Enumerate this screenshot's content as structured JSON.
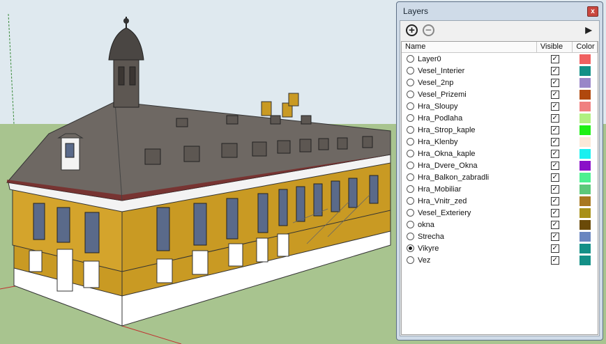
{
  "panel": {
    "title": "Layers",
    "close_label": "x",
    "toolbar": {
      "add_icon": "plus-circle-icon",
      "remove_icon": "minus-circle-icon",
      "details_icon": "details-arrow-icon"
    },
    "columns": {
      "name": "Name",
      "visible": "Visible",
      "color": "Color"
    },
    "layers": [
      {
        "name": "Layer0",
        "visible": true,
        "color": "#f06060",
        "active": false
      },
      {
        "name": "Vesel_Interier",
        "visible": true,
        "color": "#139087",
        "active": false
      },
      {
        "name": "Vesel_2np",
        "visible": true,
        "color": "#9a86c8",
        "active": false
      },
      {
        "name": "Vesel_Prizemi",
        "visible": true,
        "color": "#b0480d",
        "active": false
      },
      {
        "name": "Hra_Sloupy",
        "visible": true,
        "color": "#f08080",
        "active": false
      },
      {
        "name": "Hra_Podlaha",
        "visible": true,
        "color": "#b0f080",
        "active": false
      },
      {
        "name": "Hra_Strop_kaple",
        "visible": true,
        "color": "#1ef015",
        "active": false
      },
      {
        "name": "Hra_Klenby",
        "visible": true,
        "color": "#fae8d8",
        "active": false
      },
      {
        "name": "Hra_Okna_kaple",
        "visible": true,
        "color": "#19f0f0",
        "active": false
      },
      {
        "name": "Hra_Dvere_Okna",
        "visible": true,
        "color": "#8a10c8",
        "active": false
      },
      {
        "name": "Hra_Balkon_zabradli",
        "visible": true,
        "color": "#4cf090",
        "active": false
      },
      {
        "name": "Hra_Mobiliar",
        "visible": true,
        "color": "#5cc87a",
        "active": false
      },
      {
        "name": "Hra_Vnitr_zed",
        "visible": true,
        "color": "#a87820",
        "active": false
      },
      {
        "name": "Vesel_Exteriery",
        "visible": true,
        "color": "#a89018",
        "active": false
      },
      {
        "name": "okna",
        "visible": true,
        "color": "#6a4a08",
        "active": false
      },
      {
        "name": "Strecha",
        "visible": true,
        "color": "#6a86c0",
        "active": false
      },
      {
        "name": "Vikyre",
        "visible": true,
        "color": "#139087",
        "active": true
      },
      {
        "name": "Vez",
        "visible": true,
        "color": "#139087",
        "active": false
      }
    ]
  },
  "scene": {
    "sky": "#dfe9ef",
    "ground": "#a8c48f",
    "roof": "#6e6863",
    "wall_yellow": "#c99a23",
    "wall_white": "#f3f3f3"
  }
}
